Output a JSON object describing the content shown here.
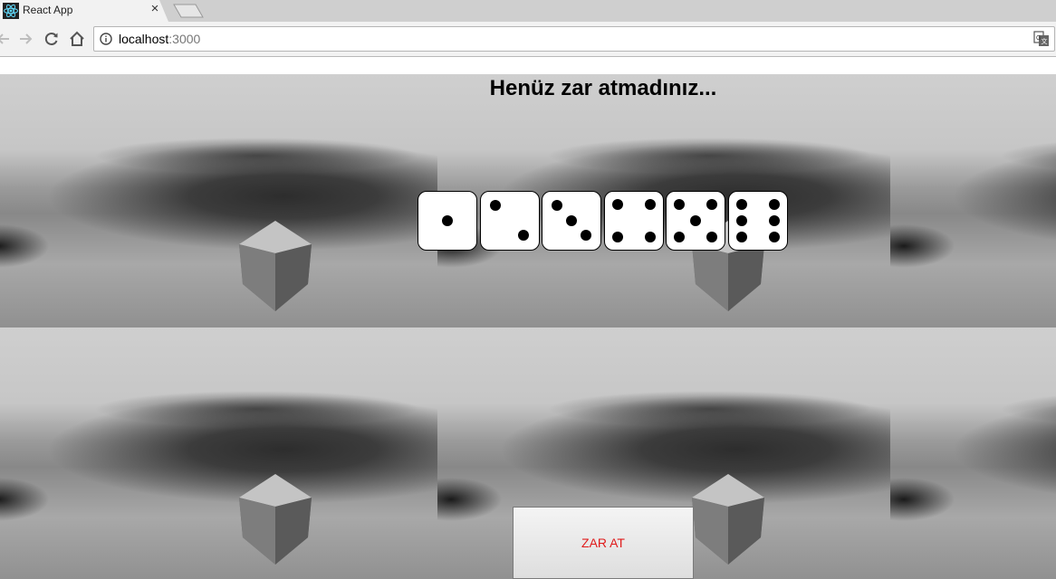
{
  "browser": {
    "tab_title": "React App",
    "tab_close": "×",
    "url_host": "localhost",
    "url_port": ":3000"
  },
  "page": {
    "heading": "Henüz zar atmadınız...",
    "button_label": "ZAR AT",
    "dice_faces": [
      1,
      2,
      3,
      4,
      5,
      6
    ],
    "colors": {
      "button_text": "#e01b1b",
      "die_face": "#ffffff",
      "pip": "#000000"
    }
  }
}
